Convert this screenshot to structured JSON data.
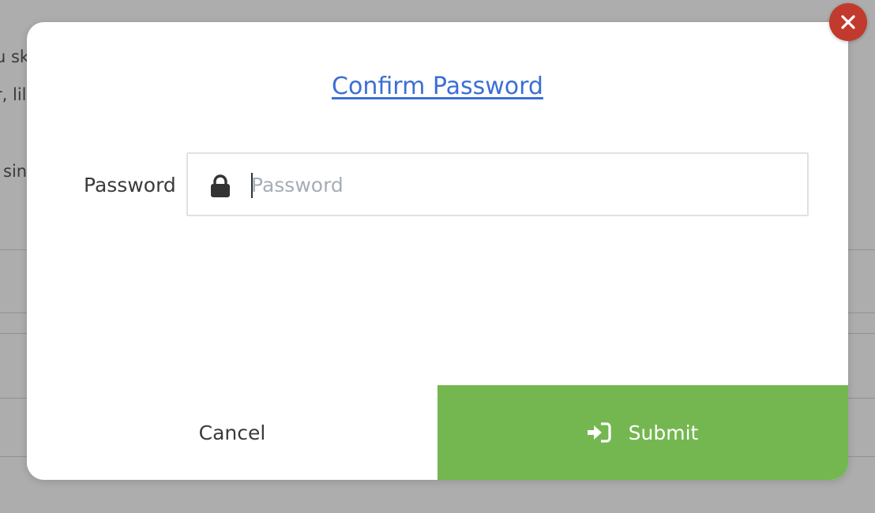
{
  "background": {
    "text_fragments": [
      "u sk",
      "r, lil",
      "sin"
    ]
  },
  "modal": {
    "title": "Confirm Password",
    "field_label": "Password",
    "input": {
      "placeholder": "Password",
      "value": "",
      "icon": "lock-icon"
    },
    "cancel_label": "Cancel",
    "submit_label": "Submit",
    "submit_icon": "sign-in-icon",
    "close_icon": "close-icon"
  },
  "colors": {
    "title_link": "#3b6fd4",
    "submit_bg": "#74b750",
    "close_bg": "#c23a2e"
  }
}
